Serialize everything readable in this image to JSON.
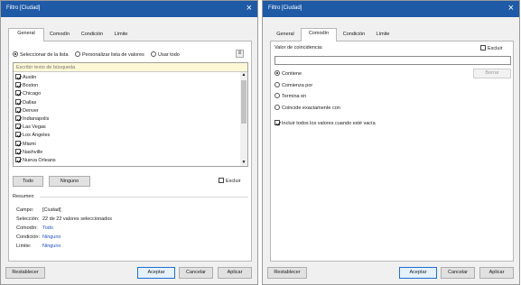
{
  "left": {
    "title": "Filtro [Ciudad]",
    "tabs": [
      "General",
      "Comodín",
      "Condición",
      "Límite"
    ],
    "radios": [
      "Seleccionar de la lista",
      "Personalizar lista de valores",
      "Usar todo"
    ],
    "search_placeholder": "Escribir texto de búsqueda",
    "cities": [
      "Austin",
      "Boston",
      "Chicago",
      "Dallas",
      "Denver",
      "Indianapolis",
      "Las Vegas",
      "Los Ángeles",
      "Miami",
      "Nashville",
      "Nueva Orleans"
    ],
    "todo_button": "Todo",
    "ninguno_button": "Ninguno",
    "excluir_label": "Excluir",
    "summary": {
      "header": "Resumen",
      "rows": [
        {
          "label": "Campo:",
          "value": "[Ciudad]"
        },
        {
          "label": "Selección:",
          "value": "22 de 22 valores seleccionados"
        },
        {
          "label": "Comodín:",
          "value": "Todo"
        },
        {
          "label": "Condición:",
          "value": "Ninguno"
        },
        {
          "label": "Límite:",
          "value": "Ninguno"
        }
      ]
    },
    "footer": {
      "reset": "Restablecer",
      "ok": "Aceptar",
      "cancel": "Cancelar",
      "apply": "Aplicar"
    }
  },
  "right": {
    "title": "Filtro [Ciudad]",
    "tabs": [
      "General",
      "Comodín",
      "Condición",
      "Límite"
    ],
    "match_label": "Valor de coincidencia:",
    "excluir_label": "Excluir",
    "borrar_button": "Borrar",
    "radios": [
      "Contiene",
      "Comienza por",
      "Termina en",
      "Coincide exactamente con"
    ],
    "include_all_label": "Incluir todos los valores cuando esté vacía",
    "footer": {
      "reset": "Restablecer",
      "ok": "Aceptar",
      "cancel": "Cancelar",
      "apply": "Aplicar"
    }
  },
  "colors": {
    "titlebar": "#1f5aa6",
    "search_bg": "#fff8d6",
    "link": "#1f4fc0"
  }
}
